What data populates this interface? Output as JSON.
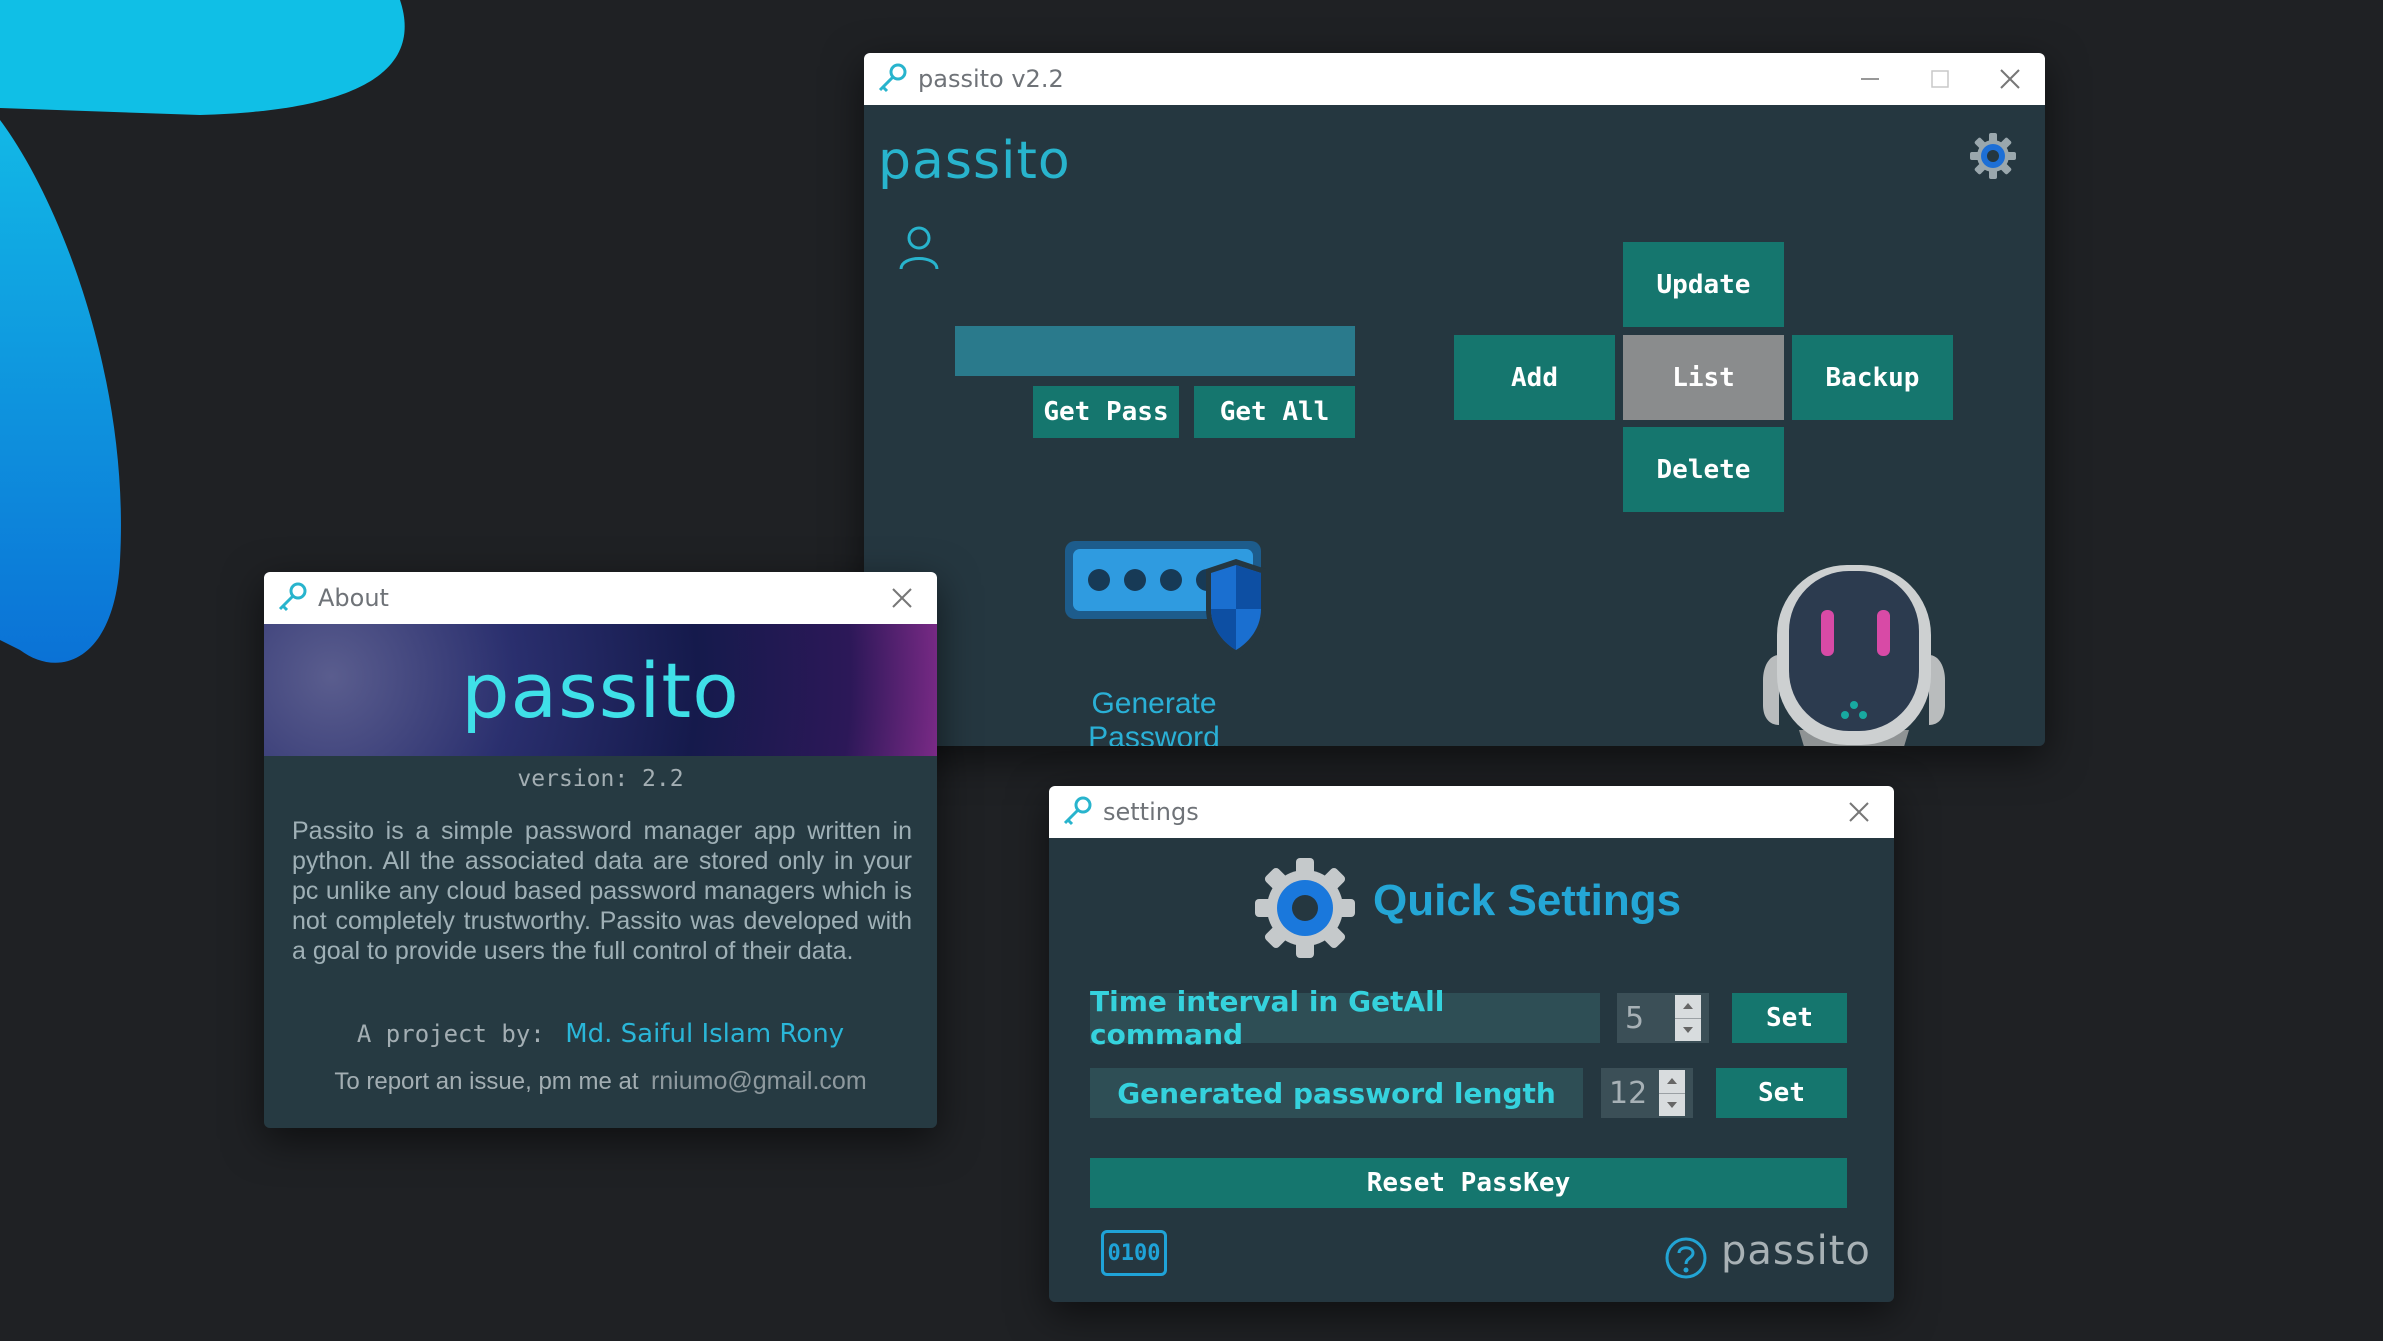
{
  "main_window": {
    "title": "passito v2.2",
    "logo": "passito",
    "buttons": {
      "update": "Update",
      "add": "Add",
      "list": "List",
      "backup": "Backup",
      "delete": "Delete",
      "get_pass": "Get Pass",
      "get_all": "Get All"
    },
    "username_input": {
      "value": "",
      "placeholder": ""
    },
    "generate_label": "Generate Password",
    "icons": {
      "app": "key-icon",
      "settings": "gear-icon",
      "user": "user-icon",
      "generate": "password-shield-icon",
      "mascot": "robot-mascot-icon"
    }
  },
  "about_window": {
    "title": "About",
    "banner_logo": "passito",
    "version": "version: 2.2",
    "description": "Passito is a simple password manager app written in python. All the associated data are stored only in your pc unlike any cloud based password managers which is not completely trustworthy. Passito was developed with a goal to provide users the full control of their data.",
    "project_by_label": "A project by:",
    "author": "Md. Saiful Islam Rony",
    "report_label": "To report an issue, pm me at",
    "email": "rniumo@gmail.com"
  },
  "settings_window": {
    "title": "settings",
    "heading": "Quick Settings",
    "rows": [
      {
        "label": "Time interval in GetAll command",
        "value": "5",
        "button": "Set"
      },
      {
        "label": "Generated password length",
        "value": "12",
        "button": "Set"
      }
    ],
    "reset_button": "Reset PassKey",
    "binary_badge": "0100",
    "footer_logo": "passito"
  },
  "colors": {
    "background": "#1f2124",
    "window_body": "#253740",
    "teal_button": "#15766e",
    "selected_button": "#8a8c8d",
    "accent_cyan": "#28b4cd",
    "label_cyan": "#35d2dd"
  }
}
